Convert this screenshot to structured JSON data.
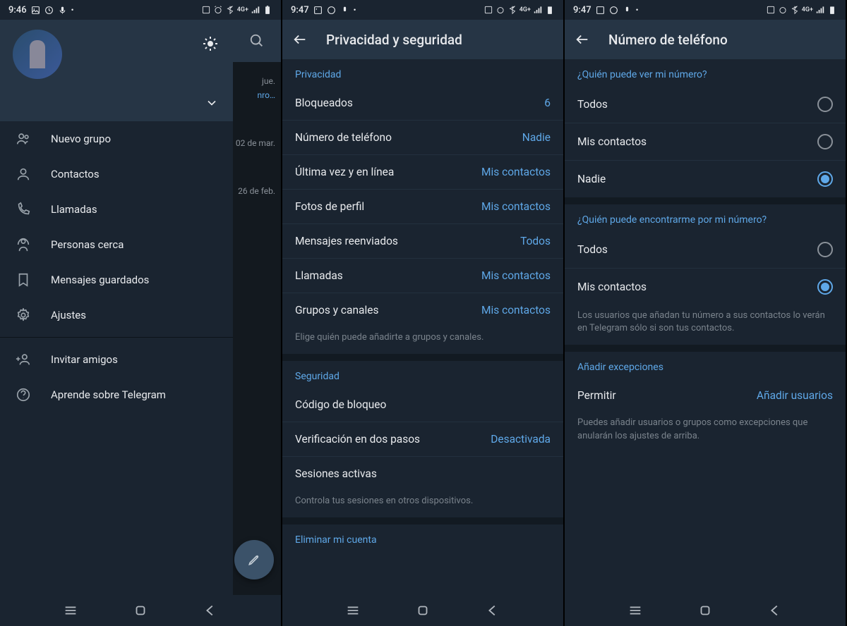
{
  "screen1": {
    "status_time": "9:46",
    "bg_dates": [
      "jue.",
      "nro…",
      "02 de mar.",
      "26 de feb."
    ],
    "drawer": {
      "items": [
        {
          "label": "Nuevo grupo"
        },
        {
          "label": "Contactos"
        },
        {
          "label": "Llamadas"
        },
        {
          "label": "Personas cerca"
        },
        {
          "label": "Mensajes guardados"
        },
        {
          "label": "Ajustes"
        }
      ],
      "items2": [
        {
          "label": "Invitar amigos"
        },
        {
          "label": "Aprende sobre Telegram"
        }
      ]
    }
  },
  "screen2": {
    "status_time": "9:47",
    "title": "Privacidad y seguridad",
    "section_privacy": "Privacidad",
    "rows": [
      {
        "label": "Bloqueados",
        "value": "6"
      },
      {
        "label": "Número de teléfono",
        "value": "Nadie"
      },
      {
        "label": "Última vez y en línea",
        "value": "Mis contactos"
      },
      {
        "label": "Fotos de perfil",
        "value": "Mis contactos"
      },
      {
        "label": "Mensajes reenviados",
        "value": "Todos"
      },
      {
        "label": "Llamadas",
        "value": "Mis contactos"
      },
      {
        "label": "Grupos y canales",
        "value": "Mis contactos"
      }
    ],
    "privacy_hint": "Elige quién puede añadirte a grupos y canales.",
    "section_security": "Seguridad",
    "security_rows": [
      {
        "label": "Código de bloqueo",
        "value": ""
      },
      {
        "label": "Verificación en dos pasos",
        "value": "Desactivada"
      },
      {
        "label": "Sesiones activas",
        "value": ""
      }
    ],
    "security_hint": "Controla tus sesiones en otros dispositivos.",
    "section_delete": "Eliminar mi cuenta"
  },
  "screen3": {
    "status_time": "9:47",
    "title": "Número de teléfono",
    "q1": "¿Quién puede ver mi número?",
    "q1_options": [
      {
        "label": "Todos",
        "selected": false
      },
      {
        "label": "Mis contactos",
        "selected": false
      },
      {
        "label": "Nadie",
        "selected": true
      }
    ],
    "q2": "¿Quién puede encontrarme por mi número?",
    "q2_options": [
      {
        "label": "Todos",
        "selected": false
      },
      {
        "label": "Mis contactos",
        "selected": true
      }
    ],
    "q2_hint": "Los usuarios que añadan tu número a sus contactos lo verán en Telegram sólo si son tus contactos.",
    "exceptions_header": "Añadir excepciones",
    "exceptions_label": "Permitir",
    "exceptions_value": "Añadir usuarios",
    "exceptions_hint": "Puedes añadir usuarios o grupos como excepciones que anularán los ajustes de arriba."
  }
}
